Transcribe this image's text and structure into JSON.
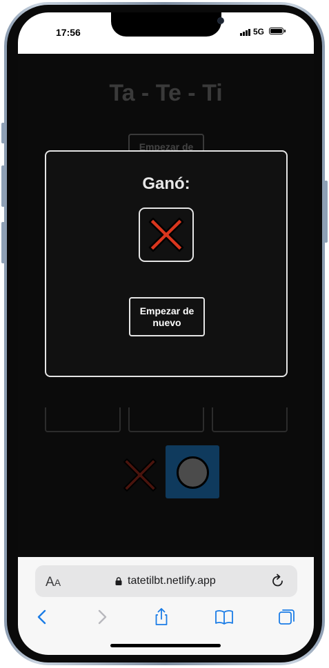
{
  "status_bar": {
    "time": "17:56",
    "network": "5G"
  },
  "page": {
    "title": "Ta - Te - Ti",
    "restart_button_top": "Empezar de nuevo",
    "turn_indicator": {
      "x_icon": "x-mark-icon",
      "o_icon": "circle-icon",
      "active": "O"
    }
  },
  "modal": {
    "winner_label": "Ganó:",
    "winner_symbol": "X",
    "winner_icon": "x-mark-icon",
    "restart_button": "Empezar de nuevo"
  },
  "safari": {
    "text_size_label_big": "A",
    "text_size_label_small": "A",
    "url": "tatetilbt.netlify.app",
    "icons": [
      "back-icon",
      "forward-icon",
      "share-icon",
      "bookmarks-icon",
      "tabs-icon"
    ]
  },
  "colors": {
    "x_color": "#d9361e",
    "o_bg": "#0f3a5d",
    "accent_blue": "#1a7ce6"
  }
}
